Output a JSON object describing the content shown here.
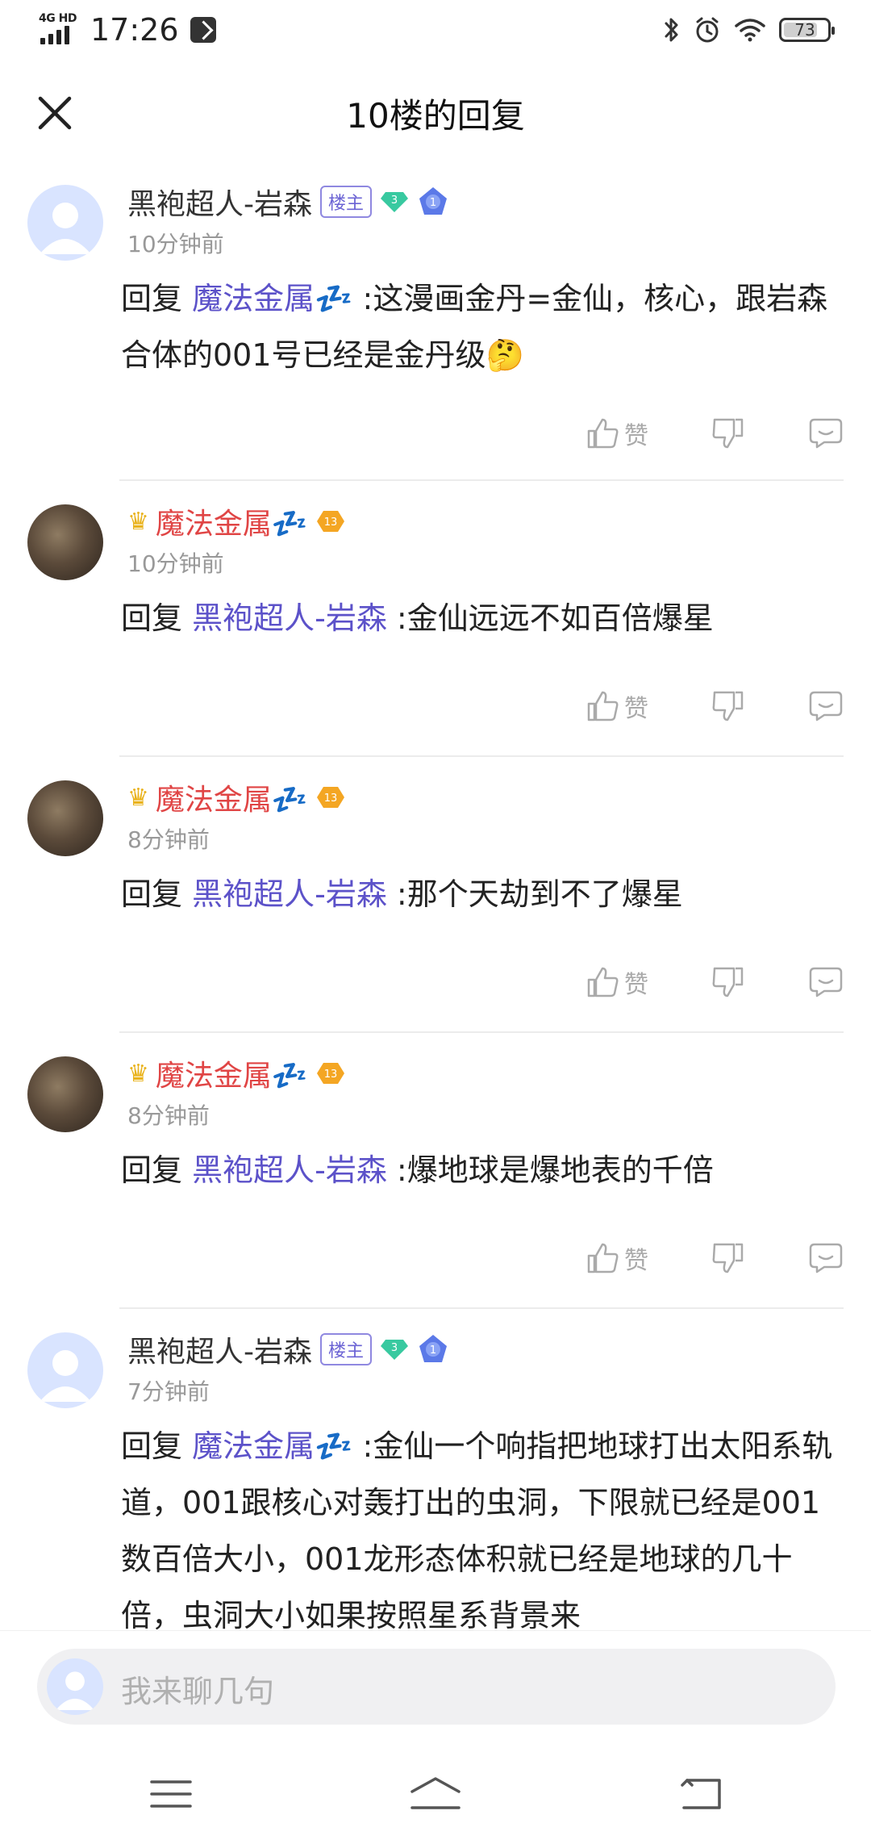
{
  "status_bar": {
    "network": "4G HD",
    "time": "17:26",
    "battery": "73"
  },
  "header": {
    "title": "10楼的回复"
  },
  "replies": [
    {
      "username": "黑袍超人-岩森",
      "owner_tag": "楼主",
      "level": "3",
      "rank": "1",
      "time": "10分钟前",
      "reply_prefix": "回复",
      "mention": "魔法金属💤",
      "text": ":这漫画金丹=金仙，核心，跟岩森合体的001号已经是金丹级🤔",
      "like_label": "赞"
    },
    {
      "username": "魔法金属💤",
      "level": "13",
      "time": "10分钟前",
      "reply_prefix": "回复",
      "mention": "黑袍超人-岩森",
      "text": ":金仙远远不如百倍爆星",
      "like_label": "赞"
    },
    {
      "username": "魔法金属💤",
      "level": "13",
      "time": "8分钟前",
      "reply_prefix": "回复",
      "mention": "黑袍超人-岩森",
      "text": ":那个天劫到不了爆星",
      "like_label": "赞"
    },
    {
      "username": "魔法金属💤",
      "level": "13",
      "time": "8分钟前",
      "reply_prefix": "回复",
      "mention": "黑袍超人-岩森",
      "text": ":爆地球是爆地表的千倍",
      "like_label": "赞"
    },
    {
      "username": "黑袍超人-岩森",
      "owner_tag": "楼主",
      "level": "3",
      "rank": "1",
      "time": "7分钟前",
      "reply_prefix": "回复",
      "mention": "魔法金属💤",
      "text": ":金仙一个响指把地球打出太阳系轨道，001跟核心对轰打出的虫洞，下限就已经是001数百倍大小，001龙形态体积就已经是地球的几十倍，虫洞大小如果按照星系背景来"
    }
  ],
  "input": {
    "placeholder": "我来聊几句"
  },
  "colors": {
    "mention": "#5c52c9",
    "vip_name": "#e04545",
    "muted": "#999999"
  }
}
